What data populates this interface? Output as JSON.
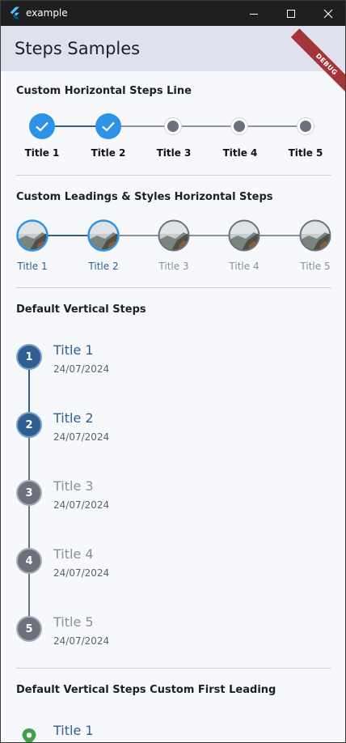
{
  "window": {
    "title": "example"
  },
  "appbar": {
    "title": "Steps Samples",
    "debug_banner": "DEBUG"
  },
  "colors": {
    "active": "#2f93e5",
    "active_line": "#2f5f90",
    "inactive": "#6c717d",
    "vertical_active": "#2f5f90",
    "vertical_inactive": "#6c717d",
    "pin": "#43a047"
  },
  "section1": {
    "title": "Custom Horizontal Steps Line",
    "steps": [
      {
        "label": "Title 1",
        "state": "done"
      },
      {
        "label": "Title 2",
        "state": "done"
      },
      {
        "label": "Title 3",
        "state": "pending"
      },
      {
        "label": "Title 4",
        "state": "pending"
      },
      {
        "label": "Title 5",
        "state": "pending"
      }
    ]
  },
  "section2": {
    "title": "Custom Leadings & Styles Horizontal Steps",
    "steps": [
      {
        "label": "Title 1",
        "state": "active"
      },
      {
        "label": "Title 2",
        "state": "active"
      },
      {
        "label": "Title 3",
        "state": "inactive"
      },
      {
        "label": "Title 4",
        "state": "inactive"
      },
      {
        "label": "Title 5",
        "state": "inactive"
      }
    ]
  },
  "section3": {
    "title": "Default Vertical Steps",
    "steps": [
      {
        "number": "1",
        "title": "Title 1",
        "date": "24/07/2024",
        "state": "active"
      },
      {
        "number": "2",
        "title": "Title 2",
        "date": "24/07/2024",
        "state": "active"
      },
      {
        "number": "3",
        "title": "Title 3",
        "date": "24/07/2024",
        "state": "inactive"
      },
      {
        "number": "4",
        "title": "Title 4",
        "date": "24/07/2024",
        "state": "inactive"
      },
      {
        "number": "5",
        "title": "Title 5",
        "date": "24/07/2024",
        "state": "inactive"
      }
    ]
  },
  "section4": {
    "title": "Default Vertical Steps Custom First Leading",
    "steps": [
      {
        "title": "Title 1",
        "leading_icon": "location-pin-icon"
      }
    ]
  }
}
